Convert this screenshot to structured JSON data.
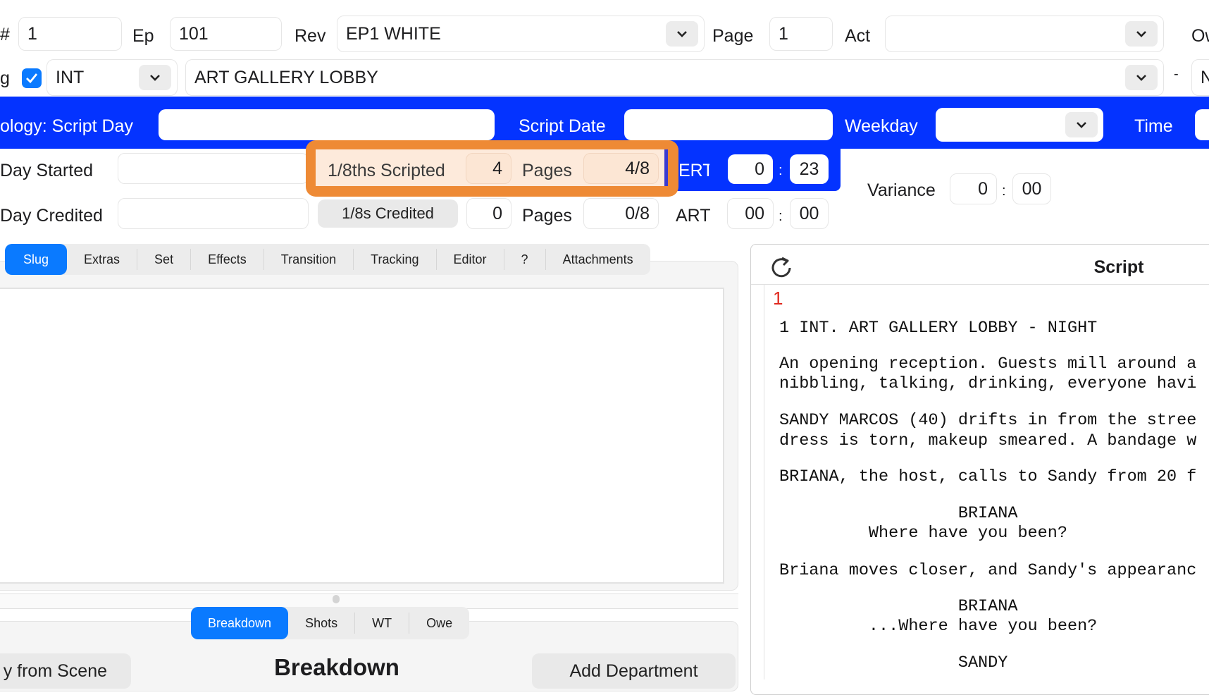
{
  "row1": {
    "scene_label": "#",
    "scene_value": "1",
    "ep_label": "Ep",
    "ep_value": "101",
    "rev_label": "Rev",
    "rev_value": "EP1 WHITE",
    "page_label": "Page",
    "page_value": "1",
    "act_label": "Act",
    "act_value": "",
    "ow_label": "Ow"
  },
  "row2": {
    "slug_label": "g",
    "slug_checked": true,
    "int_ext": "INT",
    "location": "ART GALLERY LOBBY",
    "dash": "-",
    "time_of_day": "N"
  },
  "chronology": {
    "script_day_label": "ology: Script Day",
    "script_day_value": "",
    "script_date_label": "Script Date",
    "script_date_value": "",
    "weekday_label": "Weekday",
    "weekday_value": "",
    "time_label": "Time"
  },
  "timing": {
    "day_started_label": "Day Started",
    "day_started_value": "",
    "eighths_scripted_label": "1/8ths Scripted",
    "eighths_scripted_value": "4",
    "pages_label": "Pages",
    "pages_scripted_value": "4/8",
    "ert_label": "ERT",
    "ert_min": "0",
    "ert_sec": "23",
    "variance_label": "Variance",
    "variance_min": "0",
    "variance_sec": "00",
    "day_credited_label": "Day Credited",
    "day_credited_value": "",
    "credited_button": "1/8s Credited",
    "eighths_credited_value": "0",
    "pages_credited_value": "0/8",
    "art_label": "ART",
    "art_min": "00",
    "art_sec": "00",
    "colon": ":"
  },
  "tabs": [
    "Slug",
    "Extras",
    "Set",
    "Effects",
    "Transition",
    "Tracking",
    "Editor",
    "?",
    "Attachments"
  ],
  "bottom_tabs": [
    "Breakdown",
    "Shots",
    "WT",
    "Owe"
  ],
  "breakdown": {
    "copy_button": "y from Scene",
    "title": "Breakdown",
    "add_button": "Add Department"
  },
  "script": {
    "title": "Script",
    "page_number": "1",
    "lines": [
      "1 INT. ART GALLERY LOBBY - NIGHT",
      "An opening reception. Guests mill around a",
      "nibbling, talking, drinking, everyone havi",
      "SANDY MARCOS (40) drifts in from the stree",
      "dress is torn, makeup smeared. A bandage w",
      "BRIANA, the host, calls to Sandy from 20 f",
      "                  BRIANA",
      "         Where have you been?",
      "Briana moves closer, and Sandy's appearanc",
      "                  BRIANA",
      "         ...Where have you been?",
      "                  SANDY"
    ]
  },
  "colors": {
    "band": "#0433ff",
    "accent": "#0a7aff",
    "highlight": "#ee8a35",
    "script_page": "#e0281e"
  }
}
